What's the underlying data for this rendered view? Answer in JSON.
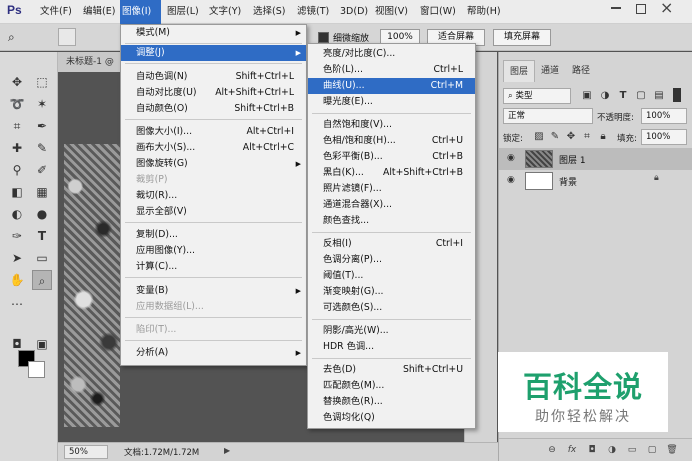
{
  "app": {
    "logo": "Ps"
  },
  "menubar": {
    "items": [
      "文件(F)",
      "编辑(E)",
      "图像(I)",
      "图层(L)",
      "文字(Y)",
      "选择(S)",
      "滤镜(T)",
      "3D(D)",
      "视图(V)",
      "窗口(W)",
      "帮助(H)"
    ],
    "active": "图像(I)"
  },
  "optionsbar": {
    "checkbox_label": "细微缩放",
    "zoom_value": "100%",
    "fit_screen_label": "适合屏幕",
    "fill_screen_label": "填充屏幕"
  },
  "document": {
    "tab_title": "未标题-1 @",
    "zoom": "50%",
    "doc_info": "文档:1.72M/1.72M"
  },
  "image_menu": {
    "items": [
      {
        "label": "模式(M)",
        "submenu": true
      },
      {
        "separator": true
      },
      {
        "label": "调整(J)",
        "submenu": true,
        "highlight": true
      },
      {
        "separator": true
      },
      {
        "label": "自动色调(N)",
        "shortcut": "Shift+Ctrl+L"
      },
      {
        "label": "自动对比度(U)",
        "shortcut": "Alt+Shift+Ctrl+L"
      },
      {
        "label": "自动颜色(O)",
        "shortcut": "Shift+Ctrl+B"
      },
      {
        "separator": true
      },
      {
        "label": "图像大小(I)...",
        "shortcut": "Alt+Ctrl+I"
      },
      {
        "label": "画布大小(S)...",
        "shortcut": "Alt+Ctrl+C"
      },
      {
        "label": "图像旋转(G)",
        "submenu": true
      },
      {
        "label": "裁剪(P)",
        "disabled": true
      },
      {
        "label": "裁切(R)..."
      },
      {
        "label": "显示全部(V)"
      },
      {
        "separator": true
      },
      {
        "label": "复制(D)..."
      },
      {
        "label": "应用图像(Y)..."
      },
      {
        "label": "计算(C)..."
      },
      {
        "separator": true
      },
      {
        "label": "变量(B)",
        "submenu": true
      },
      {
        "label": "应用数据组(L)...",
        "disabled": true
      },
      {
        "separator": true
      },
      {
        "label": "陷印(T)...",
        "disabled": true
      },
      {
        "separator": true
      },
      {
        "label": "分析(A)",
        "submenu": true
      }
    ]
  },
  "adjust_menu": {
    "items": [
      {
        "label": "亮度/对比度(C)..."
      },
      {
        "label": "色阶(L)...",
        "shortcut": "Ctrl+L"
      },
      {
        "label": "曲线(U)...",
        "shortcut": "Ctrl+M",
        "highlight": true
      },
      {
        "label": "曝光度(E)..."
      },
      {
        "separator": true
      },
      {
        "label": "自然饱和度(V)..."
      },
      {
        "label": "色相/饱和度(H)...",
        "shortcut": "Ctrl+U"
      },
      {
        "label": "色彩平衡(B)...",
        "shortcut": "Ctrl+B"
      },
      {
        "label": "黑白(K)...",
        "shortcut": "Alt+Shift+Ctrl+B"
      },
      {
        "label": "照片滤镜(F)..."
      },
      {
        "label": "通道混合器(X)..."
      },
      {
        "label": "颜色查找..."
      },
      {
        "separator": true
      },
      {
        "label": "反相(I)",
        "shortcut": "Ctrl+I"
      },
      {
        "label": "色调分离(P)..."
      },
      {
        "label": "阈值(T)..."
      },
      {
        "label": "渐变映射(G)..."
      },
      {
        "label": "可选颜色(S)..."
      },
      {
        "separator": true
      },
      {
        "label": "阴影/高光(W)..."
      },
      {
        "label": "HDR 色调..."
      },
      {
        "separator": true
      },
      {
        "label": "去色(D)",
        "shortcut": "Shift+Ctrl+U"
      },
      {
        "label": "匹配颜色(M)..."
      },
      {
        "label": "替换颜色(R)..."
      },
      {
        "label": "色调均化(Q)"
      }
    ]
  },
  "layers_panel": {
    "tabs": [
      "图层",
      "通道",
      "路径"
    ],
    "filter_label": "类型",
    "blend_mode": "正常",
    "opacity_label": "不透明度:",
    "opacity_value": "100%",
    "lock_label": "锁定:",
    "fill_label": "填充:",
    "fill_value": "100%",
    "layers": [
      {
        "name": "图层 1",
        "selected": true
      },
      {
        "name": "背景",
        "selected": false,
        "locked": true
      }
    ]
  },
  "watermark": {
    "title": "百科全说",
    "subtitle": "助你轻松解决"
  },
  "colors": {
    "accent": "#2f6cc5",
    "watermark_green": "#1ea06d"
  }
}
